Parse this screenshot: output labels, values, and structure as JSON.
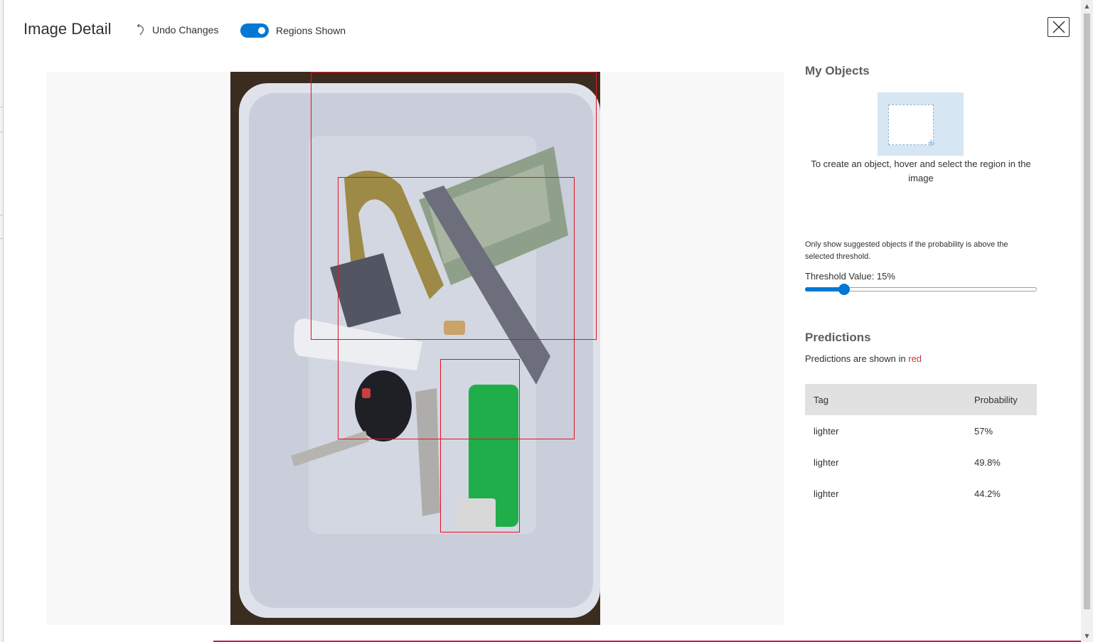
{
  "header": {
    "title": "Image Detail",
    "undo_label": "Undo Changes",
    "regions_toggle": {
      "label": "Regions Shown",
      "on": true
    }
  },
  "panel": {
    "my_objects": {
      "title": "My Objects",
      "hint": "To create an object, hover and select the region in the image"
    },
    "threshold": {
      "note": "Only show suggested objects if the probability is above the selected threshold.",
      "label": "Threshold Value: 15%",
      "value_percent": 15
    },
    "predictions": {
      "title": "Predictions",
      "note_prefix": "Predictions are shown in ",
      "note_color_word": "red",
      "columns": {
        "tag": "Tag",
        "probability": "Probability"
      },
      "rows": [
        {
          "tag": "lighter",
          "probability": "57%"
        },
        {
          "tag": "lighter",
          "probability": "49.8%"
        },
        {
          "tag": "lighter",
          "probability": "44.2%"
        }
      ]
    }
  },
  "colors": {
    "accent": "#0078d4",
    "prediction_box": "#e81123"
  },
  "icons": {
    "undo": "undo-icon",
    "close": "close-icon",
    "add_region": "plus-icon"
  }
}
